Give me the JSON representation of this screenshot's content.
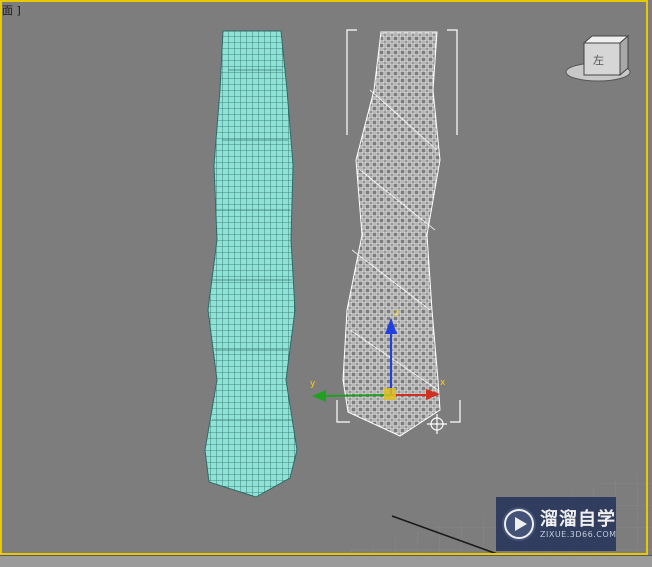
{
  "viewport": {
    "label": "面 ]"
  },
  "gizmo": {
    "x_axis": "x",
    "y_axis": "y",
    "z_axis": "z"
  },
  "viewcube": {
    "face_label": "左"
  },
  "watermark": {
    "title": "溜溜自学",
    "subtitle": "ZIXUE.3D66.COM",
    "icon": "play-icon"
  },
  "colors": {
    "viewport_bg": "#7d7d7d",
    "active_border": "#e8c800",
    "tower_left": "#8fe3d6",
    "tower_right_wire": "#ffffff",
    "gizmo_x": "#d03020",
    "gizmo_y": "#20a020",
    "gizmo_z": "#2040e0"
  }
}
